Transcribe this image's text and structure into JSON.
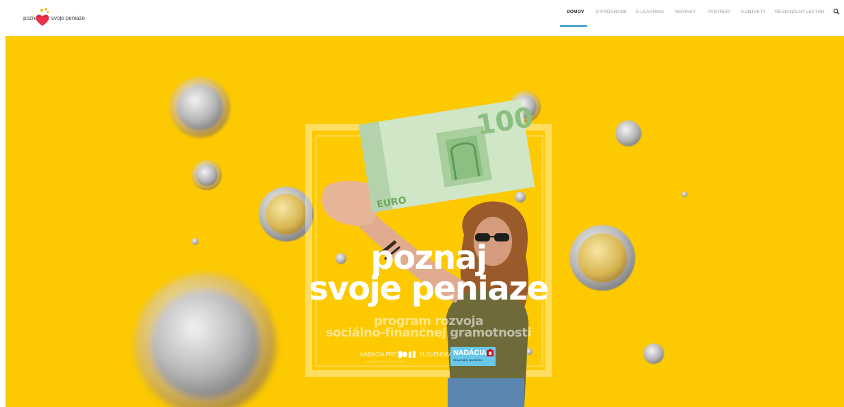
{
  "brand": {
    "left_word": "poznaj",
    "right_word": "svoje peniaze"
  },
  "nav": {
    "items": [
      {
        "label": "DOMOV",
        "active": true
      },
      {
        "label": "O PROGRAME",
        "active": false
      },
      {
        "label": "E-LEARNING",
        "active": false
      },
      {
        "label": "NOVINKY",
        "active": false
      },
      {
        "label": "PARTNERI",
        "active": false
      },
      {
        "label": "KONTAKTY",
        "active": false
      },
      {
        "label": "REGIONÁLNY LEKTOR",
        "active": false
      }
    ],
    "search_icon": "search-icon",
    "active_color": "#1e8fb8"
  },
  "hero": {
    "background": "#fdc900",
    "title_line1": "poznaj",
    "title_line2": "svoje peniaze",
    "subtitle_line1": "program rozvoja",
    "subtitle_line2": "sociálno-finančnej gramotnosti",
    "banknote_value": "100",
    "banknote_currency": "EURO",
    "sponsor1_left": "NADÁCIA PRE",
    "sponsor1_right": "SLOVENSKA",
    "sponsor1_sub": "ZMENAME SPOLU SLOVENSKO",
    "sponsor2_name": "NADÁCIA",
    "sponsor2_sub": "Slovenskej sporiteľne"
  }
}
